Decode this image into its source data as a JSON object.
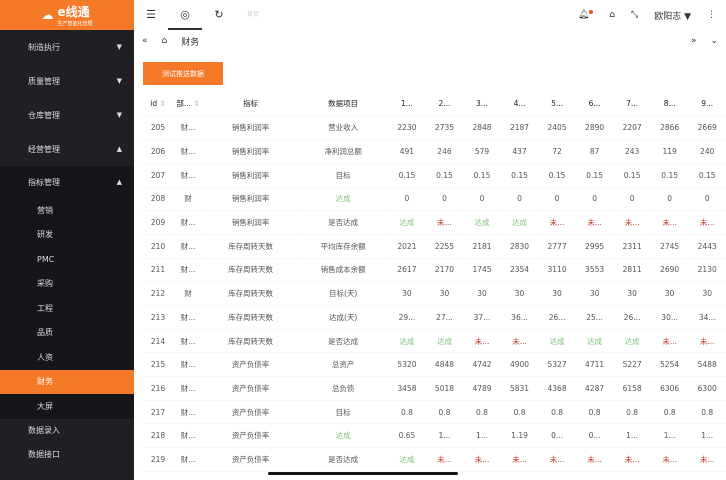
{
  "logo": {
    "text": "e线通",
    "sub": "生产智能化管理"
  },
  "sidebar": {
    "groups": [
      {
        "label": "制造执行",
        "open": false
      },
      {
        "label": "质量管理",
        "open": false
      },
      {
        "label": "仓库管理",
        "open": false
      },
      {
        "label": "经营管理",
        "open": true
      }
    ],
    "subgroup": "指标管理",
    "items": [
      "营销",
      "研发",
      "PMC",
      "采购",
      "工程",
      "品质",
      "人资",
      "财务",
      "大屏"
    ],
    "active": "财务",
    "bottom": [
      "数据录入",
      "数据接口"
    ]
  },
  "topbar": {
    "page_hint": "首页",
    "user": "欧阳志"
  },
  "tabs": {
    "current": "财务"
  },
  "button": "测试推送数据",
  "colors": {
    "accent": "#f47a28",
    "ok": "#7cc47c",
    "fail": "#c0392b"
  },
  "table": {
    "headers": [
      "id",
      "部...",
      "指标",
      "数据项目",
      "1...",
      "2...",
      "3...",
      "4...",
      "5...",
      "6...",
      "7...",
      "8...",
      "9..."
    ],
    "rows": [
      [
        "205",
        "财...",
        "销售利润率",
        "营业收入",
        "2230",
        "2735",
        "2848",
        "2187",
        "2405",
        "2890",
        "2207",
        "2866",
        "2669"
      ],
      [
        "206",
        "财...",
        "销售利润率",
        "净利润总额",
        "491",
        "246",
        "579",
        "437",
        "72",
        "87",
        "243",
        "119",
        "240"
      ],
      [
        "207",
        "财...",
        "销售利润率",
        "目标",
        "0.15",
        "0.15",
        "0.15",
        "0.15",
        "0.15",
        "0.15",
        "0.15",
        "0.15",
        "0.15"
      ],
      [
        "208",
        "财",
        "销售利润率",
        "达成",
        "0",
        "0",
        "0",
        "0",
        "0",
        "0",
        "0",
        "0",
        "0"
      ],
      [
        "209",
        "财...",
        "销售利润率",
        "是否达成",
        "达成",
        "未...",
        "达成",
        "达成",
        "未...",
        "未...",
        "未...",
        "未...",
        "未..."
      ],
      [
        "210",
        "财...",
        "库存周转天数",
        "平均库存余额",
        "2021",
        "2255",
        "2181",
        "2830",
        "2777",
        "2995",
        "2311",
        "2745",
        "2443"
      ],
      [
        "211",
        "财...",
        "库存周转天数",
        "销售成本余额",
        "2617",
        "2170",
        "1745",
        "2354",
        "3110",
        "3553",
        "2811",
        "2690",
        "2130"
      ],
      [
        "212",
        "财",
        "库存周转天数",
        "目标(天)",
        "30",
        "30",
        "30",
        "30",
        "30",
        "30",
        "30",
        "30",
        "30"
      ],
      [
        "213",
        "财...",
        "库存周转天数",
        "达成(天)",
        "29...",
        "27...",
        "37...",
        "36...",
        "26...",
        "25...",
        "26...",
        "30...",
        "34..."
      ],
      [
        "214",
        "财...",
        "库存周转天数",
        "是否达成",
        "达成",
        "达成",
        "未...",
        "未...",
        "达成",
        "达成",
        "达成",
        "未...",
        "未..."
      ],
      [
        "215",
        "财...",
        "资产负债率",
        "总资产",
        "5320",
        "4848",
        "4742",
        "4900",
        "5327",
        "4711",
        "5227",
        "5254",
        "5488"
      ],
      [
        "216",
        "财...",
        "资产负债率",
        "总负债",
        "3458",
        "5018",
        "4789",
        "5831",
        "4368",
        "4287",
        "6158",
        "6306",
        "6300"
      ],
      [
        "217",
        "财...",
        "资产负债率",
        "目标",
        "0.8",
        "0.8",
        "0.8",
        "0.8",
        "0.8",
        "0.8",
        "0.8",
        "0.8",
        "0.8"
      ],
      [
        "218",
        "财...",
        "资产负债率",
        "达成",
        "0.65",
        "1...",
        "1...",
        "1.19",
        "0...",
        "0...",
        "1...",
        "1...",
        "1..."
      ],
      [
        "219",
        "财...",
        "资产负债率",
        "是否达成",
        "达成",
        "未...",
        "未...",
        "未...",
        "未...",
        "未...",
        "未...",
        "未...",
        "未..."
      ]
    ]
  }
}
